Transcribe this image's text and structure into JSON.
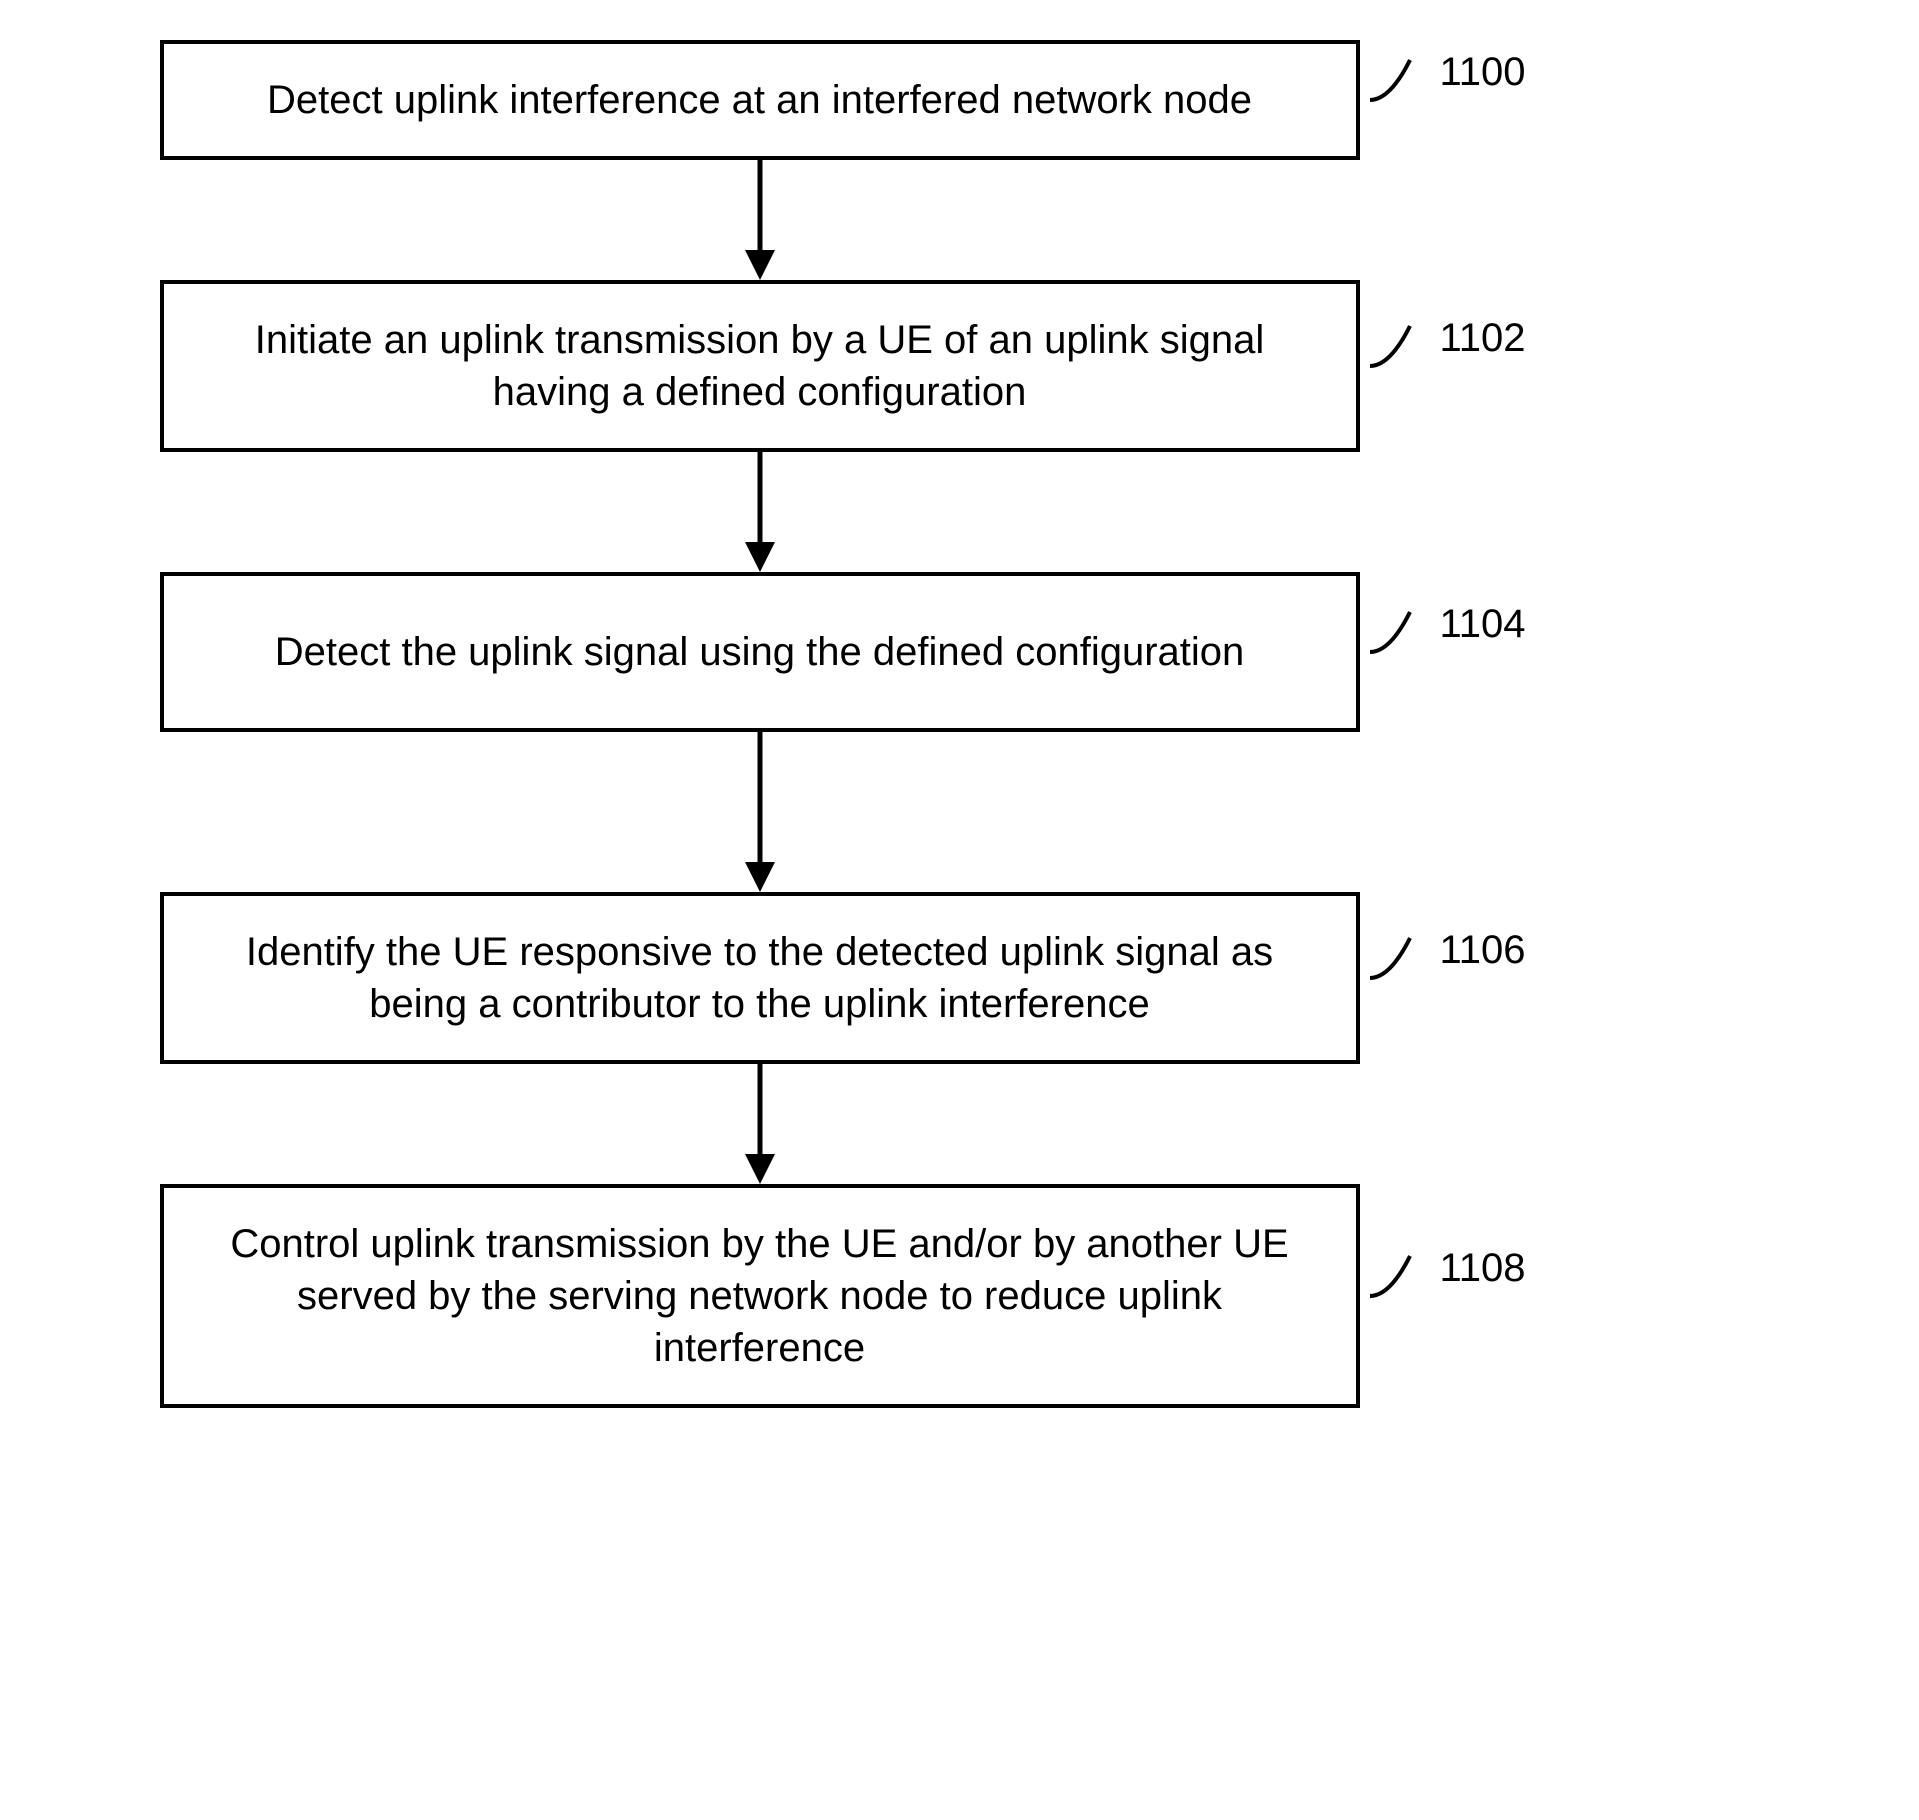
{
  "flowchart": {
    "steps": [
      {
        "text": "Detect uplink interference at an interfered network node",
        "label": "1100"
      },
      {
        "text": "Initiate an uplink transmission by a UE of an uplink signal having a defined configuration",
        "label": "1102"
      },
      {
        "text": "Detect the uplink signal using the defined configuration",
        "label": "1104"
      },
      {
        "text": "Identify the UE responsive to the detected uplink signal as being a contributor to the uplink interference",
        "label": "1106"
      },
      {
        "text": "Control uplink transmission by the UE and/or by another UE served by the serving network node to reduce uplink interference",
        "label": "1108"
      }
    ]
  }
}
